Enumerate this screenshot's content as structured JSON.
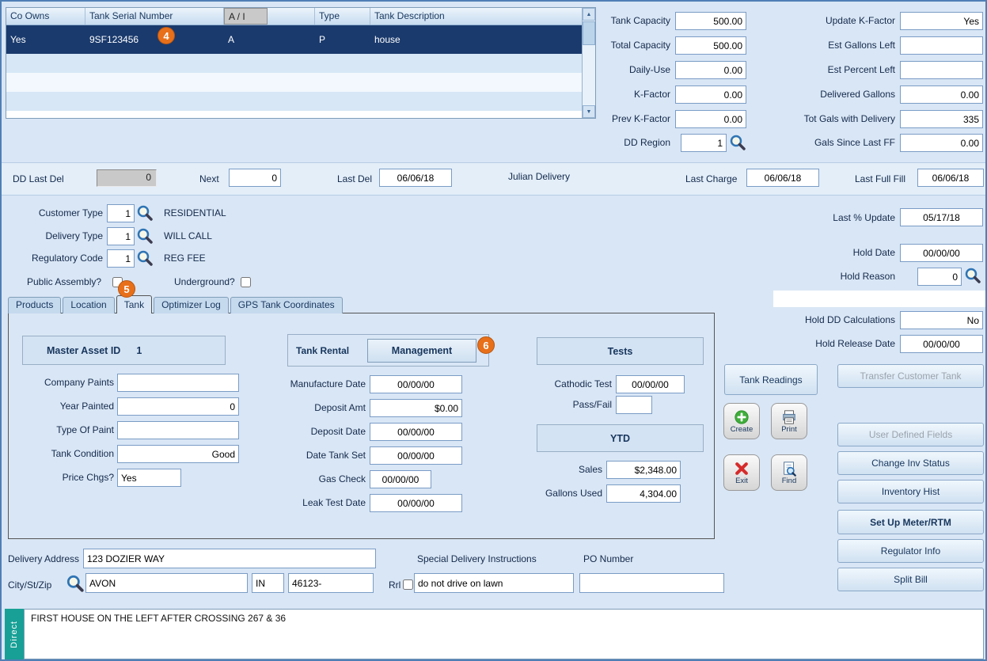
{
  "colors": {
    "accent_orange": "#e8701a",
    "selected_row": "#1a3a6d",
    "direct_teal": "#18a096"
  },
  "badges": {
    "b4": "4",
    "b5": "5",
    "b6": "6"
  },
  "grid": {
    "headers": [
      "Co Owns",
      "Tank Serial Number",
      "A / I",
      "",
      "Type",
      "Tank Description"
    ],
    "row": {
      "co_owns": "Yes",
      "serial": "9SF123456",
      "a_i": "A",
      "type": "P",
      "desc": "house"
    }
  },
  "capacity": {
    "tank_capacity_label": "Tank Capacity",
    "tank_capacity": "500.00",
    "total_capacity_label": "Total Capacity",
    "total_capacity": "500.00",
    "daily_use_label": "Daily-Use",
    "daily_use": "0.00",
    "k_factor_label": "K-Factor",
    "k_factor": "0.00",
    "prev_k_factor_label": "Prev K-Factor",
    "prev_k_factor": "0.00",
    "dd_region_label": "DD Region",
    "dd_region": "1",
    "update_k_label": "Update K-Factor",
    "update_k": "Yes",
    "est_gallons_label": "Est Gallons Left",
    "est_gallons": "",
    "est_percent_label": "Est Percent Left",
    "est_percent": "",
    "delivered_label": "Delivered Gallons",
    "delivered": "0.00",
    "tot_gals_label": "Tot Gals with Delivery",
    "tot_gals": "335",
    "gals_since_label": "Gals Since Last FF",
    "gals_since": "0.00"
  },
  "strip": {
    "dd_last_del_label": "DD Last Del",
    "dd_last_del": "0",
    "next_label": "Next",
    "next": "0",
    "last_del_label": "Last  Del",
    "last_del": "06/06/18",
    "julian_label": "Julian Delivery",
    "last_charge_label": "Last Charge",
    "last_charge": "06/06/18",
    "last_full_fill_label": "Last Full Fill",
    "last_full_fill": "06/06/18"
  },
  "customer": {
    "customer_type_label": "Customer Type",
    "customer_type": "1",
    "customer_type_desc": "RESIDENTIAL",
    "delivery_type_label": "Delivery Type",
    "delivery_type": "1",
    "delivery_type_desc": "WILL CALL",
    "regulatory_code_label": "Regulatory Code",
    "regulatory_code": "1",
    "regulatory_code_desc": "REG FEE",
    "public_assembly_label": "Public Assembly?",
    "underground_label": "Underground?"
  },
  "hold": {
    "last_pct_label": "Last % Update",
    "last_pct": "05/17/18",
    "hold_date_label": "Hold Date",
    "hold_date": "00/00/00",
    "hold_reason_label": "Hold Reason",
    "hold_reason": "0",
    "hold_dd_label": "Hold DD Calculations",
    "hold_dd": "No",
    "hold_release_label": "Hold Release Date",
    "hold_release": "00/00/00"
  },
  "tabs": [
    "Products",
    "Location",
    "Tank",
    "Optimizer Log",
    "GPS Tank Coordinates"
  ],
  "tank_tab": {
    "master_asset_label": "Master Asset ID",
    "master_asset_value": "1",
    "company_paints_label": "Company Paints",
    "company_paints": "",
    "year_painted_label": "Year Painted",
    "year_painted": "0",
    "type_of_paint_label": "Type Of Paint",
    "type_of_paint": "",
    "tank_condition_label": "Tank Condition",
    "tank_condition": "Good",
    "price_chgs_label": "Price Chgs?",
    "price_chgs": "Yes",
    "tank_rental_label": "Tank Rental",
    "management_btn": "Management",
    "manufacture_date_label": "Manufacture Date",
    "manufacture_date": "00/00/00",
    "deposit_amt_label": "Deposit Amt",
    "deposit_amt": "$0.00",
    "deposit_date_label": "Deposit Date",
    "deposit_date": "00/00/00",
    "date_tank_set_label": "Date Tank Set",
    "date_tank_set": "00/00/00",
    "gas_check_label": "Gas Check",
    "gas_check": "00/00/00",
    "leak_test_label": "Leak Test Date",
    "leak_test": "00/00/00",
    "tests_header": "Tests",
    "cathodic_label": "Cathodic Test",
    "cathodic": "00/00/00",
    "pass_fail_label": "Pass/Fail",
    "pass_fail": "",
    "ytd_header": "YTD",
    "sales_label": "Sales",
    "sales": "$2,348.00",
    "gallons_used_label": "Gallons Used",
    "gallons_used": "4,304.00"
  },
  "actions": {
    "tank_readings": "Tank Readings",
    "transfer_customer_tank": "Transfer Customer Tank",
    "create": "Create",
    "print": "Print",
    "exit": "Exit",
    "find": "Find",
    "user_defined_fields": "User Defined Fields",
    "change_inv_status": "Change Inv Status",
    "inventory_hist": "Inventory Hist",
    "setup_meter": "Set Up Meter/RTM",
    "regulator_info": "Regulator Info",
    "split_bill": "Split Bill"
  },
  "address": {
    "delivery_address_label": "Delivery Address",
    "delivery_address": "123 DOZIER WAY",
    "special_instr_label": "Special Delivery Instructions",
    "po_number_label": "PO Number",
    "city_label": "City/St/Zip",
    "city": "AVON",
    "state": "IN",
    "zip": "46123-",
    "rrl_label": "Rrl",
    "special_instr": "do not drive on lawn",
    "po_number": ""
  },
  "direct": {
    "tab_label": "Direct",
    "note": "FIRST HOUSE ON THE LEFT AFTER CROSSING 267 & 36"
  }
}
